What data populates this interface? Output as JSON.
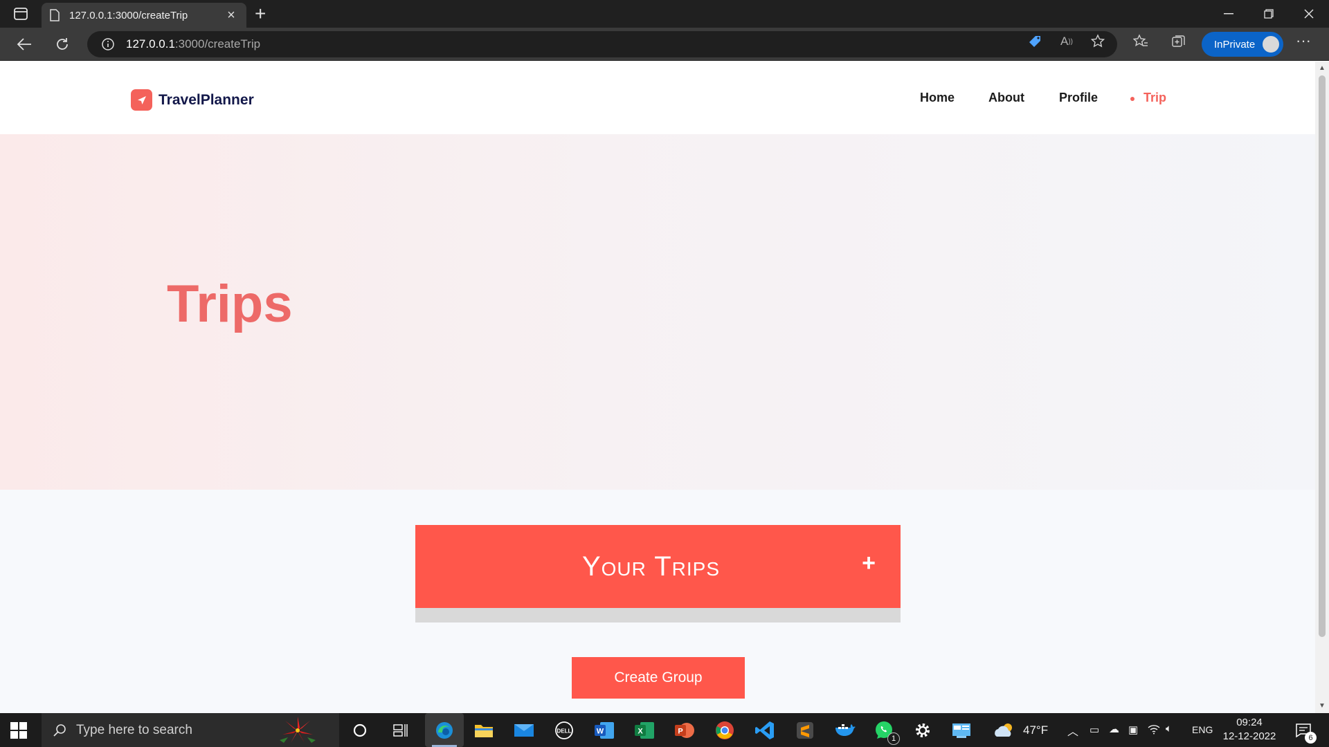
{
  "browser": {
    "tab_title": "127.0.0.1:3000/createTrip",
    "url_host": "127.0.0.1",
    "url_rest": ":3000/createTrip",
    "inprivate_label": "InPrivate"
  },
  "site": {
    "brand": "TravelPlanner",
    "nav": [
      "Home",
      "About",
      "Profile",
      "Trip"
    ],
    "active_nav": "Trip",
    "accent_color": "#f4625b"
  },
  "hero": {
    "title": "Trips"
  },
  "trips_panel": {
    "heading": "Your Trips",
    "add_label": "+"
  },
  "create_group_label": "Create Group",
  "taskbar": {
    "search_placeholder": "Type here to search",
    "weather": "47°F",
    "language": "ENG",
    "time": "09:24",
    "date": "12-12-2022",
    "whatsapp_badge": "1",
    "notification_count": "6"
  }
}
